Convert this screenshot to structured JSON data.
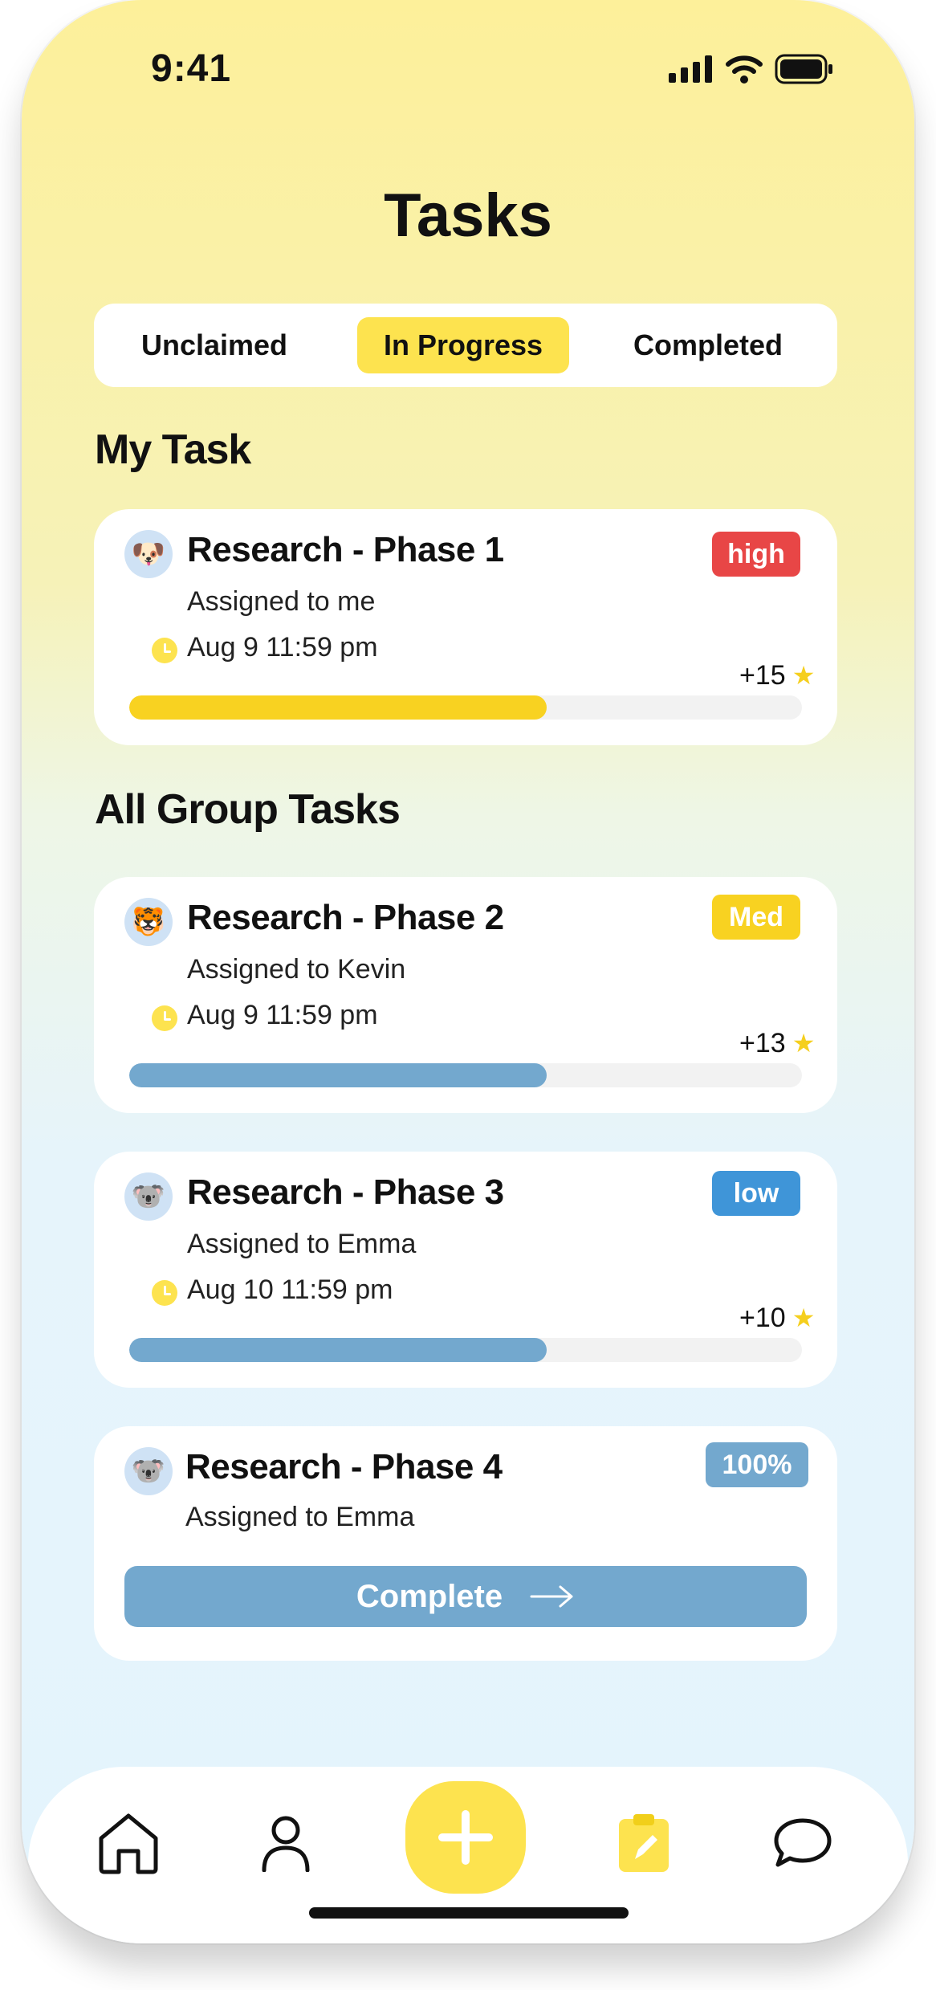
{
  "status_bar": {
    "time": "9:41"
  },
  "header": {
    "title": "Tasks"
  },
  "tabs": [
    {
      "label": "Unclaimed",
      "active": false
    },
    {
      "label": "In Progress",
      "active": true
    },
    {
      "label": "Completed",
      "active": false
    }
  ],
  "my_task": {
    "section_title": "My Task",
    "task": {
      "avatar_icon": "puppy-emoji",
      "avatar": "🐶",
      "title": "Research - Phase 1",
      "assigned": "Assigned to me",
      "due": "Aug 9 11:59 pm",
      "priority": "high",
      "priority_color": "#e84646",
      "points": "+15",
      "progress": 0.62,
      "progress_color": "#f8d221"
    }
  },
  "group_tasks": {
    "section_title": "All Group Tasks",
    "tasks": [
      {
        "avatar_icon": "tiger-emoji",
        "avatar": "🐯",
        "title": "Research - Phase 2",
        "assigned": "Assigned to Kevin",
        "due": "Aug 9 11:59 pm",
        "priority": "Med",
        "priority_color": "#f8d221",
        "points": "+13",
        "progress": 0.62,
        "progress_color": "#73a8ce"
      },
      {
        "avatar_icon": "koala-emoji",
        "avatar": "🐨",
        "title": "Research - Phase 3",
        "assigned": "Assigned to Emma",
        "due": "Aug 10 11:59 pm",
        "priority": "low",
        "priority_color": "#3f95d8",
        "points": "+10",
        "progress": 0.62,
        "progress_color": "#73a8ce"
      },
      {
        "avatar_icon": "koala-emoji",
        "avatar": "🐨",
        "title": "Research - Phase 4",
        "assigned": "Assigned to Emma",
        "percent": "100%",
        "percent_color": "#73a8ce",
        "button_label": "Complete",
        "button_icon": "arrow-right-icon"
      }
    ]
  },
  "nav": {
    "items": [
      "home-icon",
      "profile-icon",
      "add-icon",
      "tasks-clipboard-icon",
      "chat-icon"
    ],
    "active": "tasks-clipboard-icon",
    "accent": "#fde34f"
  }
}
